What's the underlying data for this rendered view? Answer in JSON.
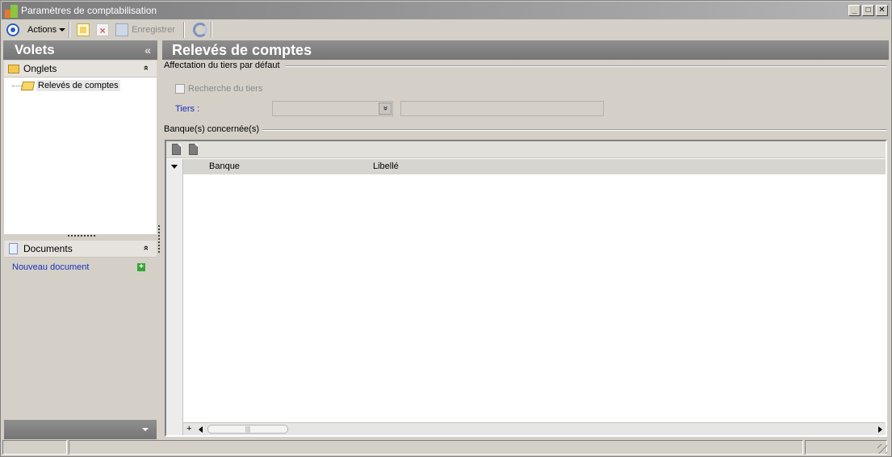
{
  "window": {
    "title": "Paramètres de comptabilisation",
    "minimize": "_",
    "maximize": "□",
    "close": "✕"
  },
  "toolbar": {
    "actions_label": "Actions",
    "save_label": "Enregistrer",
    "icons": [
      "navigation-circle-icon",
      "new-document-icon",
      "delete-icon",
      "save-icon",
      "refresh-icon"
    ]
  },
  "left_pane": {
    "title": "Volets",
    "collapse_glyph": "«",
    "onglets": {
      "label": "Onglets",
      "expand_glyph": "»",
      "items": [
        {
          "label": "Relevés de comptes"
        }
      ]
    },
    "documents": {
      "label": "Documents",
      "expand_glyph": "»",
      "new_label": "Nouveau document",
      "new_glyph": "+"
    }
  },
  "main": {
    "title": "Relevés de comptes",
    "section1": {
      "label": "Affectation du tiers par défaut",
      "checkbox_label": "Recherche du tiers",
      "checkbox_checked": false,
      "tiers_label": "Tiers  :",
      "combo_value": "",
      "text_value": "",
      "combo_glyph": "»"
    },
    "section2": {
      "label": "Banque(s) concernée(s)",
      "columns": [
        "Banque",
        "Libellé"
      ],
      "rows": [],
      "add_glyph": "+",
      "scroll_thumb": "|||"
    }
  },
  "colors": {
    "accent_blue": "#1a30b8",
    "header_gray": "#7c7c7c",
    "chrome": "#d4d0c8"
  }
}
